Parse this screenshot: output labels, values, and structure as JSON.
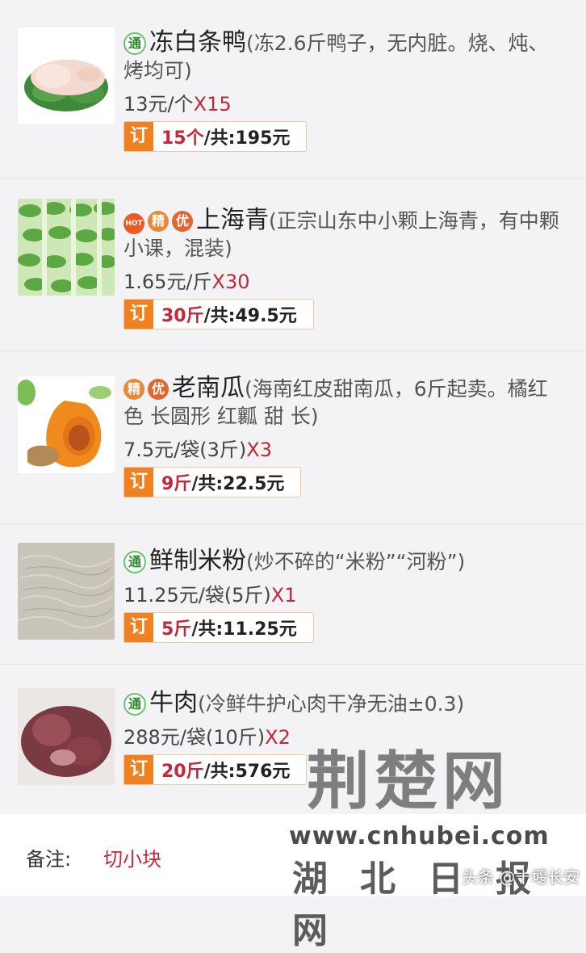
{
  "items": [
    {
      "badges": [
        "通"
      ],
      "name": "冻白条鸭",
      "desc": "(冻2.6斤鸭子，无内脏。烧、炖、烤均可)",
      "price": "13元/个",
      "qty": "X15",
      "order_qty": "15个",
      "order_total": "/共:195元",
      "image": "frozen-duck"
    },
    {
      "badges": [
        "HOT",
        "精",
        "优"
      ],
      "name": "上海青",
      "desc": "(正宗山东中小颗上海青，有中颗小课，混装)",
      "price": "1.65元/斤",
      "qty": "X30",
      "order_qty": "30斤",
      "order_total": "/共:49.5元",
      "image": "bok-choy"
    },
    {
      "badges": [
        "精",
        "优"
      ],
      "name": "老南瓜",
      "desc": "(海南红皮甜南瓜，6斤起卖。橘红色 长圆形 红瓤 甜 长)",
      "price": "7.5元/袋(3斤)",
      "qty": "X3",
      "order_qty": "9斤",
      "order_total": "/共:22.5元",
      "image": "pumpkin"
    },
    {
      "badges": [
        "通"
      ],
      "name": "鲜制米粉",
      "desc": "(炒不碎的“米粉”“河粉”)",
      "price": "11.25元/袋(5斤)",
      "qty": "X1",
      "order_qty": "5斤",
      "order_total": "/共:11.25元",
      "image": "rice-noodles"
    },
    {
      "badges": [
        "通"
      ],
      "name": "牛肉",
      "desc": "(冷鲜牛护心肉干净无油±0.3)",
      "price": "288元/袋(10斤)",
      "qty": "X2",
      "order_qty": "20斤",
      "order_total": "/共:576元",
      "image": "beef"
    }
  ],
  "order_label": "订",
  "note": {
    "label": "备注:",
    "value": "切小块"
  },
  "watermark": {
    "big": "荆楚网",
    "url": "www.cnhubei.com",
    "cn": "湖北日报网",
    "byline": "头条 @十堰长安"
  },
  "colors": {
    "accent": "#ef8121",
    "qty_red": "#c2273a",
    "badge_green": "#6cc16c"
  }
}
